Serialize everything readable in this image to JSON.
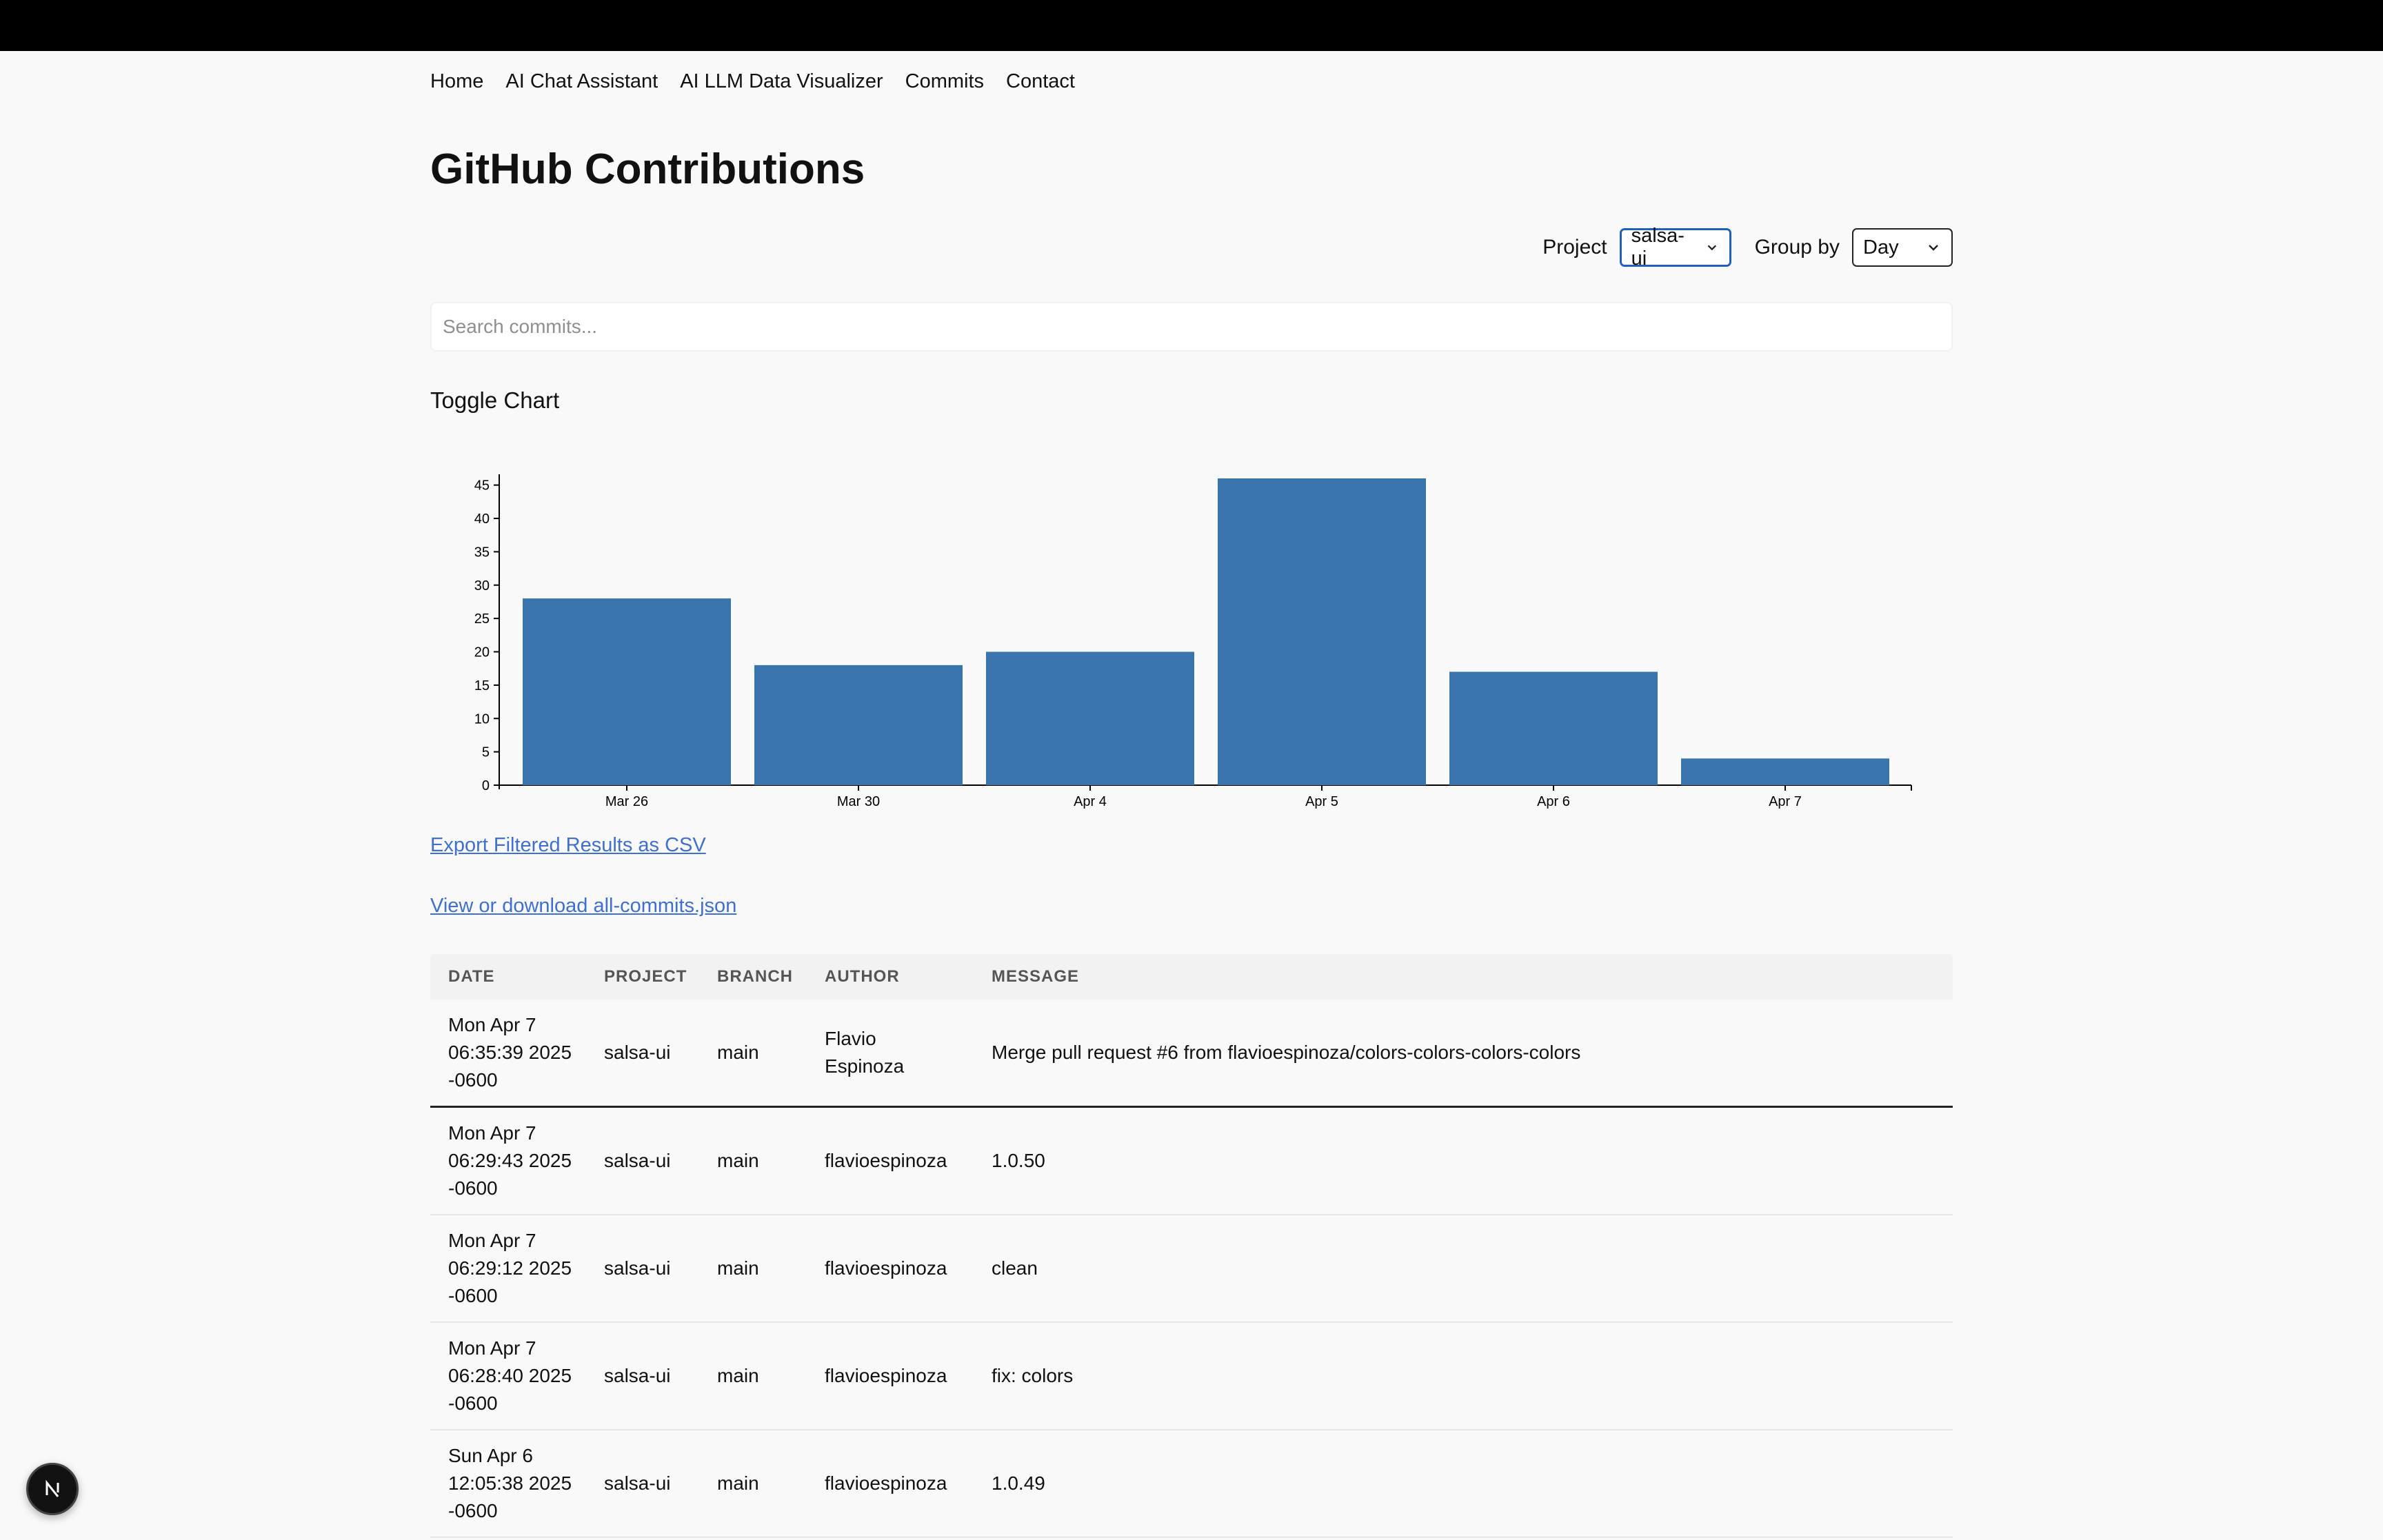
{
  "nav": {
    "items": [
      "Home",
      "AI Chat Assistant",
      "AI LLM Data Visualizer",
      "Commits",
      "Contact"
    ]
  },
  "page": {
    "title": "GitHub Contributions"
  },
  "filters": {
    "project_label": "Project",
    "project_value": "salsa-ui",
    "group_label": "Group by",
    "group_value": "Day"
  },
  "search": {
    "placeholder": "Search commits..."
  },
  "toggle_chart_label": "Toggle Chart",
  "chart_data": {
    "type": "bar",
    "categories": [
      "Mar 26",
      "Mar 30",
      "Apr 4",
      "Apr 5",
      "Apr 6",
      "Apr 7"
    ],
    "values": [
      28,
      18,
      20,
      46,
      17,
      4
    ],
    "yticks": [
      0,
      5,
      10,
      15,
      20,
      25,
      30,
      35,
      40,
      45
    ],
    "ylim": [
      0,
      46
    ],
    "title": "",
    "xlabel": "",
    "ylabel": "",
    "bar_color": "#3a74ad"
  },
  "links": {
    "export_csv": "Export Filtered Results as CSV",
    "download_json": "View or download all-commits.json"
  },
  "table": {
    "columns": [
      "Date",
      "Project",
      "Branch",
      "Author",
      "Message"
    ],
    "rows": [
      {
        "date": [
          "Mon Apr 7",
          "06:35:39 2025",
          "-0600"
        ],
        "project": "salsa-ui",
        "branch": "main",
        "author": [
          "Flavio",
          "Espinoza"
        ],
        "message": "Merge pull request #6 from flavioespinoza/colors-colors-colors-colors"
      },
      {
        "date": [
          "Mon Apr 7",
          "06:29:43 2025",
          "-0600"
        ],
        "project": "salsa-ui",
        "branch": "main",
        "author": [
          "flavioespinoza"
        ],
        "message": "1.0.50"
      },
      {
        "date": [
          "Mon Apr 7",
          "06:29:12 2025",
          "-0600"
        ],
        "project": "salsa-ui",
        "branch": "main",
        "author": [
          "flavioespinoza"
        ],
        "message": "clean"
      },
      {
        "date": [
          "Mon Apr 7",
          "06:28:40 2025",
          "-0600"
        ],
        "project": "salsa-ui",
        "branch": "main",
        "author": [
          "flavioespinoza"
        ],
        "message": "fix: colors"
      },
      {
        "date": [
          "Sun Apr 6",
          "12:05:38 2025",
          "-0600"
        ],
        "project": "salsa-ui",
        "branch": "main",
        "author": [
          "flavioespinoza"
        ],
        "message": "1.0.49"
      }
    ]
  },
  "badge": {
    "letter": "N"
  },
  "colors": {
    "accent": "#1f5fbf",
    "link": "#3f6fd1",
    "bar": "#3a74ad"
  }
}
